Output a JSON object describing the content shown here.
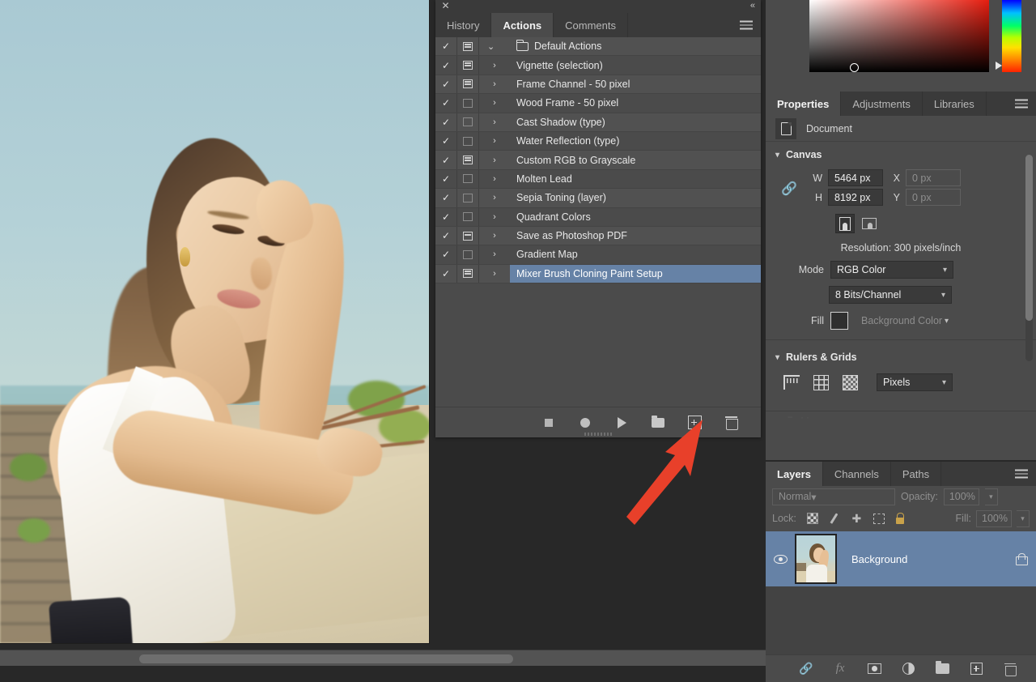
{
  "canvas": {
    "photo_alt": "portrait-photo-woman-leaning-on-wall",
    "scrollbar": "horizontal-scrollbar"
  },
  "color_picker": {
    "name": "color-picker",
    "selected_hue_hex": "#e61d0f"
  },
  "actions_panel": {
    "close_label": "✕",
    "collapse_label": "«",
    "tabs": [
      {
        "label": "History",
        "active": false
      },
      {
        "label": "Actions",
        "active": true
      },
      {
        "label": "Comments",
        "active": false
      }
    ],
    "selection_color": "#6682a6",
    "rows": [
      {
        "name": "Default Actions",
        "checked": true,
        "dialog": "on",
        "kind": "folder",
        "twisty": "⌄",
        "indent": 0,
        "selected": false
      },
      {
        "name": "Vignette (selection)",
        "checked": true,
        "dialog": "on",
        "kind": "action",
        "twisty": "›",
        "indent": 1,
        "selected": false
      },
      {
        "name": "Frame Channel - 50 pixel",
        "checked": true,
        "dialog": "on",
        "kind": "action",
        "twisty": "›",
        "indent": 1,
        "selected": false
      },
      {
        "name": "Wood Frame - 50 pixel",
        "checked": true,
        "dialog": "off",
        "kind": "action",
        "twisty": "›",
        "indent": 1,
        "selected": false
      },
      {
        "name": "Cast Shadow (type)",
        "checked": true,
        "dialog": "off",
        "kind": "action",
        "twisty": "›",
        "indent": 1,
        "selected": false
      },
      {
        "name": "Water Reflection (type)",
        "checked": true,
        "dialog": "off",
        "kind": "action",
        "twisty": "›",
        "indent": 1,
        "selected": false
      },
      {
        "name": "Custom RGB to Grayscale",
        "checked": true,
        "dialog": "on",
        "kind": "action",
        "twisty": "›",
        "indent": 1,
        "selected": false
      },
      {
        "name": "Molten Lead",
        "checked": true,
        "dialog": "off",
        "kind": "action",
        "twisty": "›",
        "indent": 1,
        "selected": false
      },
      {
        "name": "Sepia Toning (layer)",
        "checked": true,
        "dialog": "off",
        "kind": "action",
        "twisty": "›",
        "indent": 1,
        "selected": false
      },
      {
        "name": "Quadrant Colors",
        "checked": true,
        "dialog": "off",
        "kind": "action",
        "twisty": "›",
        "indent": 1,
        "selected": false
      },
      {
        "name": "Save as Photoshop PDF",
        "checked": true,
        "dialog": "titled",
        "kind": "action",
        "twisty": "›",
        "indent": 1,
        "selected": false
      },
      {
        "name": "Gradient Map",
        "checked": true,
        "dialog": "off",
        "kind": "action",
        "twisty": "›",
        "indent": 1,
        "selected": false
      },
      {
        "name": "Mixer Brush Cloning Paint Setup",
        "checked": true,
        "dialog": "on",
        "kind": "action",
        "twisty": "›",
        "indent": 1,
        "selected": true
      }
    ],
    "footer_buttons": [
      {
        "name": "stop-playing-recording-button"
      },
      {
        "name": "begin-recording-button"
      },
      {
        "name": "play-selection-button"
      },
      {
        "name": "create-new-set-button"
      },
      {
        "name": "create-new-action-button"
      },
      {
        "name": "delete-button"
      }
    ]
  },
  "properties_panel": {
    "tabs": [
      {
        "label": "Properties",
        "active": true
      },
      {
        "label": "Adjustments",
        "active": false
      },
      {
        "label": "Libraries",
        "active": false
      }
    ],
    "document_label": "Document",
    "canvas_section": {
      "title": "Canvas",
      "w_label": "W",
      "w_value": "5464 px",
      "x_label": "X",
      "x_placeholder": "0 px",
      "h_label": "H",
      "h_value": "8192 px",
      "y_label": "Y",
      "y_placeholder": "0 px",
      "orientation": "portrait",
      "resolution": "Resolution: 300 pixels/inch",
      "mode_label": "Mode",
      "mode_value": "RGB Color",
      "depth_value": "8 Bits/Channel",
      "fill_label": "Fill",
      "fill_value": "Background Color"
    },
    "rulers_section": {
      "title": "Rulers & Grids",
      "units_value": "Pixels"
    }
  },
  "layers_panel": {
    "tabs": [
      {
        "label": "Layers",
        "active": true
      },
      {
        "label": "Channels",
        "active": false
      },
      {
        "label": "Paths",
        "active": false
      }
    ],
    "blend_mode": "Normal",
    "opacity_label": "Opacity:",
    "opacity_value": "100%",
    "lock_label": "Lock:",
    "fill_label": "Fill:",
    "fill_value": "100%",
    "layers": [
      {
        "name": "Background",
        "visible": true,
        "locked": true,
        "selected": true
      }
    ],
    "footer_buttons": [
      {
        "name": "link-layers-button"
      },
      {
        "name": "layer-style-fx-button"
      },
      {
        "name": "add-layer-mask-button"
      },
      {
        "name": "new-adjustment-layer-button"
      },
      {
        "name": "new-group-button"
      },
      {
        "name": "new-layer-button"
      },
      {
        "name": "delete-layer-button"
      }
    ]
  },
  "annotation": {
    "arrow_color": "#e8402a",
    "points_to": "create-new-action-button"
  }
}
